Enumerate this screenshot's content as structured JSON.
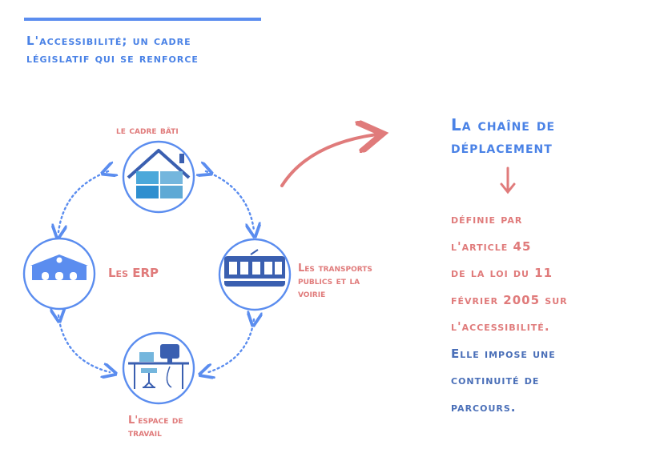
{
  "header": {
    "title_line1": "L'accessibilité; un cadre",
    "title_line2": "législatif qui se renforce"
  },
  "nodes": {
    "bati": {
      "label": "le cadre bâti",
      "icon": "house-icon"
    },
    "erp": {
      "label": "Les ERP",
      "icon": "public-building-icon"
    },
    "transports": {
      "label_line1": "Les transports",
      "label_line2": "publics et la",
      "label_line3": "voirie",
      "icon": "tram-icon"
    },
    "travail": {
      "label_line1": "L'espace de",
      "label_line2": "travail",
      "icon": "workstation-icon"
    }
  },
  "right": {
    "title_line1": "La chaîne de",
    "title_line2": "déplacement",
    "text_lines": [
      "définie par",
      "l'article 45",
      "de la loi du 11",
      "février 2005 sur",
      "l'accessibilité."
    ],
    "text_lines_blue": [
      "Elle impose une",
      "continuité de",
      "parcours."
    ]
  },
  "colors": {
    "blue": "#5b8def",
    "light_blue": "#74b6dd",
    "red": "#e07b7b",
    "navy": "#3a5fb0"
  }
}
